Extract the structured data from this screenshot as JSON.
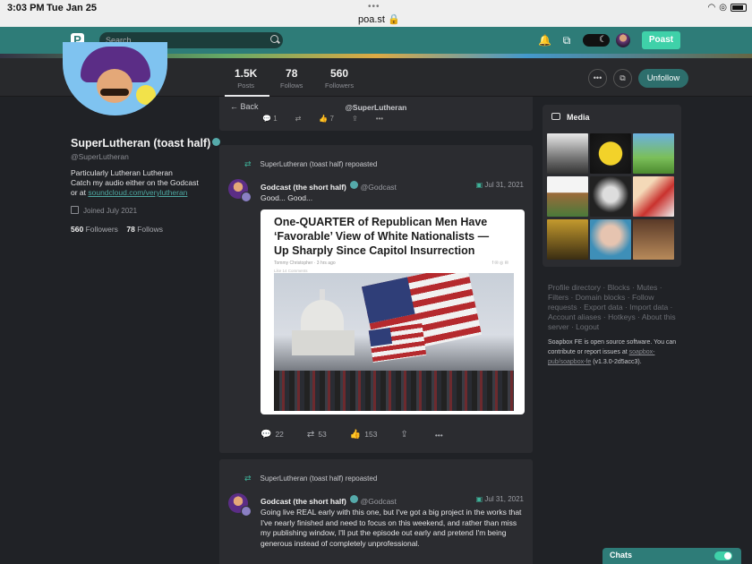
{
  "statusbar": {
    "time": "3:03 PM",
    "date": "Tue Jan 25",
    "dots": "•••",
    "url": "poa.st 🔒"
  },
  "topnav": {
    "search_placeholder": "Search",
    "poast_label": "Poast"
  },
  "profile": {
    "display_name": "SuperLutheran (toast half)",
    "handle": "@SuperLutheran",
    "bio_line1": "Particularly Lutheran Lutheran",
    "bio_line2": "Catch my audio either on the Godcast",
    "bio_prefix": "or at ",
    "bio_link": "soundcloud.com/verylutheran",
    "joined": "Joined July 2021",
    "followers_count": "560",
    "followers_label": "Followers",
    "follows_count": "78",
    "follows_label": "Follows"
  },
  "stats": [
    {
      "value": "1.5K",
      "label": "Posts"
    },
    {
      "value": "78",
      "label": "Follows"
    },
    {
      "value": "560",
      "label": "Followers"
    }
  ],
  "unfollow_label": "Unfollow",
  "backbar": {
    "back_label": "Back",
    "title": "@SuperLutheran"
  },
  "top_actions": {
    "reply": "1",
    "like": "7"
  },
  "posts": [
    {
      "repost_by": "SuperLutheran (toast half) repoasted",
      "author": "Godcast (the short half)",
      "acct": "@Godcast",
      "date": "Jul 31, 2021",
      "text": "Good... Good...",
      "card": {
        "title": "One-QUARTER of Republican Men Have ‘Favorable’ View of White Nationalists — Up Sharply Since Capitol Insurrection",
        "byline": "Tommy Christopher · 3 hrs ago",
        "meta": "Like    14 Comments"
      },
      "replies": "22",
      "reposts": "53",
      "likes": "153"
    },
    {
      "repost_by": "SuperLutheran (toast half) repoasted",
      "author": "Godcast (the short half)",
      "acct": "@Godcast",
      "date": "Jul 31, 2021",
      "text": "Going live REAL early with this one, but I've got a big project in the works that I've nearly finished and need to focus on this weekend, and rather than miss my publishing window, I'll put the episode out early and pretend I'm being generous instead of completely unprofessional."
    }
  ],
  "media": {
    "title": "Media"
  },
  "footer_links": "Profile directory · Blocks · Mutes · Filters · Domain blocks · Follow requests · Export data · Import data · Account aliases · Hotkeys · About this server · Logout",
  "soapbox": {
    "text": "Soapbox FE is open source software. You can contribute or report issues at ",
    "link": "soapbox-pub/soapbox-fe",
    "version": " (v1.3.0-2d5acc3)."
  },
  "chats": {
    "label": "Chats"
  },
  "colors": {
    "accent": "#2e7c78",
    "poast": "#3fd1a9",
    "background": "#202226",
    "panel": "#2b2c30"
  }
}
